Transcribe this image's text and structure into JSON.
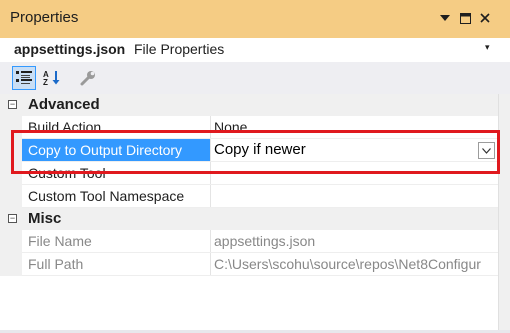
{
  "window": {
    "title": "Properties",
    "accent": "#f5cc84",
    "controls": {
      "dropdown_icon": "chevron-down-icon",
      "pin_icon": "restore-window-icon",
      "close_icon": "close-icon"
    }
  },
  "object": {
    "name": "appsettings.json",
    "type": "File Properties"
  },
  "toolbar": {
    "buttons": [
      {
        "icon": "categorized-icon",
        "active": true
      },
      {
        "icon": "alphabetical-sort-icon",
        "active": false
      },
      {
        "icon": "property-pages-wrench-icon",
        "active": false
      }
    ]
  },
  "grid": {
    "categories": [
      {
        "label": "Advanced",
        "expanded": true,
        "properties": [
          {
            "name": "Build Action",
            "value": "None"
          },
          {
            "name": "Copy to Output Directory",
            "value": "Copy if newer",
            "selected": true
          },
          {
            "name": "Custom Tool",
            "value": ""
          },
          {
            "name": "Custom Tool Namespace",
            "value": ""
          }
        ]
      },
      {
        "label": "Misc",
        "expanded": true,
        "properties": [
          {
            "name": "File Name",
            "value": "appsettings.json",
            "readonly": true
          },
          {
            "name": "Full Path",
            "value": "C:\\Users\\scohu\\source\\repos\\Net8Configur",
            "readonly": true
          }
        ]
      }
    ],
    "selection_color": "#3399ff",
    "highlight_color": "#e0191e"
  }
}
